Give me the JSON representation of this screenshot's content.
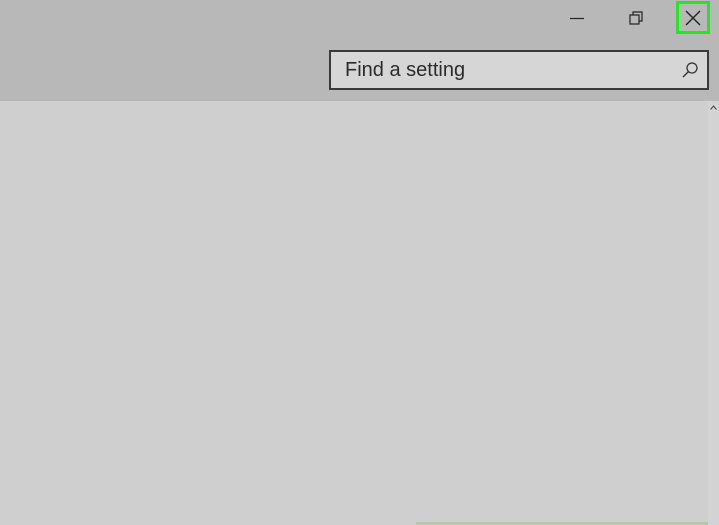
{
  "window": {
    "controls": {
      "minimize_icon": "minimize-icon",
      "restore_icon": "restore-icon",
      "close_icon": "close-icon",
      "close_highlight_color": "#22e822"
    }
  },
  "search": {
    "placeholder": "Find a setting",
    "value": "",
    "icon": "search-icon"
  },
  "colors": {
    "header_bg": "#b8b8b8",
    "content_bg": "#cfcfcf",
    "text": "#2b2b2b"
  }
}
